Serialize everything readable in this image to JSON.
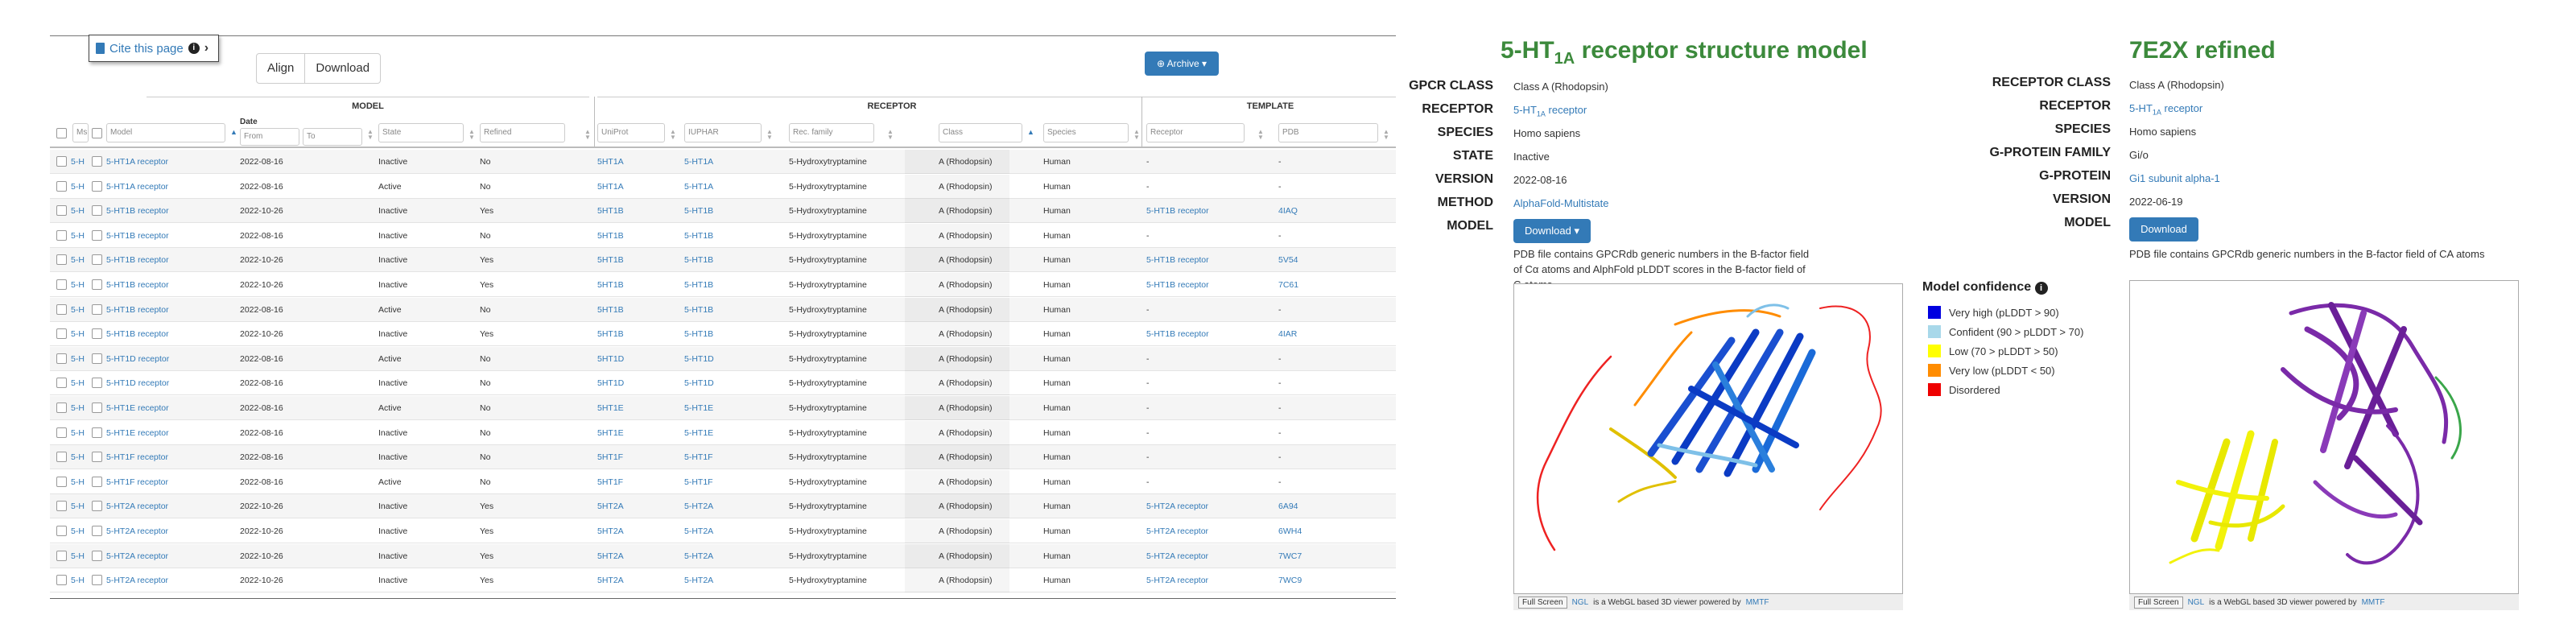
{
  "left": {
    "cite_label": "Cite this page",
    "buttons": {
      "align": "Align",
      "download": "Download"
    },
    "archive_label": "Archive",
    "groups": {
      "model": "MODEL",
      "receptor": "RECEPTOR",
      "template": "TEMPLATE"
    },
    "headers": {
      "ms": "Ms",
      "model": "Model",
      "date": "Date",
      "date_from": "From",
      "date_to": "To",
      "state": "State",
      "refined": "Refined",
      "uniprot": "UniProt",
      "iuphar": "IUPHAR",
      "rec_family": "Rec. family",
      "class": "Class",
      "species": "Species",
      "receptor": "Receptor",
      "pdb": "PDB"
    },
    "rows": [
      {
        "ms": "5-H",
        "model": "5-HT1A receptor",
        "date": "2022-08-16",
        "state": "Inactive",
        "refined": "No",
        "uniprot": "5HT1A",
        "iuphar": "5-HT1A",
        "family": "5-Hydroxytryptamine",
        "cls": "A (Rhodopsin)",
        "species": "Human",
        "treceptor": "-",
        "pdb": "-"
      },
      {
        "ms": "5-H",
        "model": "5-HT1A receptor",
        "date": "2022-08-16",
        "state": "Active",
        "refined": "No",
        "uniprot": "5HT1A",
        "iuphar": "5-HT1A",
        "family": "5-Hydroxytryptamine",
        "cls": "A (Rhodopsin)",
        "species": "Human",
        "treceptor": "-",
        "pdb": "-"
      },
      {
        "ms": "5-H",
        "model": "5-HT1B receptor",
        "date": "2022-10-26",
        "state": "Inactive",
        "refined": "Yes",
        "uniprot": "5HT1B",
        "iuphar": "5-HT1B",
        "family": "5-Hydroxytryptamine",
        "cls": "A (Rhodopsin)",
        "species": "Human",
        "treceptor": "5-HT1B receptor",
        "pdb": "4IAQ"
      },
      {
        "ms": "5-H",
        "model": "5-HT1B receptor",
        "date": "2022-08-16",
        "state": "Inactive",
        "refined": "No",
        "uniprot": "5HT1B",
        "iuphar": "5-HT1B",
        "family": "5-Hydroxytryptamine",
        "cls": "A (Rhodopsin)",
        "species": "Human",
        "treceptor": "-",
        "pdb": "-"
      },
      {
        "ms": "5-H",
        "model": "5-HT1B receptor",
        "date": "2022-10-26",
        "state": "Inactive",
        "refined": "Yes",
        "uniprot": "5HT1B",
        "iuphar": "5-HT1B",
        "family": "5-Hydroxytryptamine",
        "cls": "A (Rhodopsin)",
        "species": "Human",
        "treceptor": "5-HT1B receptor",
        "pdb": "5V54"
      },
      {
        "ms": "5-H",
        "model": "5-HT1B receptor",
        "date": "2022-10-26",
        "state": "Inactive",
        "refined": "Yes",
        "uniprot": "5HT1B",
        "iuphar": "5-HT1B",
        "family": "5-Hydroxytryptamine",
        "cls": "A (Rhodopsin)",
        "species": "Human",
        "treceptor": "5-HT1B receptor",
        "pdb": "7C61"
      },
      {
        "ms": "5-H",
        "model": "5-HT1B receptor",
        "date": "2022-08-16",
        "state": "Active",
        "refined": "No",
        "uniprot": "5HT1B",
        "iuphar": "5-HT1B",
        "family": "5-Hydroxytryptamine",
        "cls": "A (Rhodopsin)",
        "species": "Human",
        "treceptor": "-",
        "pdb": "-"
      },
      {
        "ms": "5-H",
        "model": "5-HT1B receptor",
        "date": "2022-10-26",
        "state": "Inactive",
        "refined": "Yes",
        "uniprot": "5HT1B",
        "iuphar": "5-HT1B",
        "family": "5-Hydroxytryptamine",
        "cls": "A (Rhodopsin)",
        "species": "Human",
        "treceptor": "5-HT1B receptor",
        "pdb": "4IAR"
      },
      {
        "ms": "5-H",
        "model": "5-HT1D receptor",
        "date": "2022-08-16",
        "state": "Active",
        "refined": "No",
        "uniprot": "5HT1D",
        "iuphar": "5-HT1D",
        "family": "5-Hydroxytryptamine",
        "cls": "A (Rhodopsin)",
        "species": "Human",
        "treceptor": "-",
        "pdb": "-"
      },
      {
        "ms": "5-H",
        "model": "5-HT1D receptor",
        "date": "2022-08-16",
        "state": "Inactive",
        "refined": "No",
        "uniprot": "5HT1D",
        "iuphar": "5-HT1D",
        "family": "5-Hydroxytryptamine",
        "cls": "A (Rhodopsin)",
        "species": "Human",
        "treceptor": "-",
        "pdb": "-"
      },
      {
        "ms": "5-H",
        "model": "5-HT1E receptor",
        "date": "2022-08-16",
        "state": "Active",
        "refined": "No",
        "uniprot": "5HT1E",
        "iuphar": "5-HT1E",
        "family": "5-Hydroxytryptamine",
        "cls": "A (Rhodopsin)",
        "species": "Human",
        "treceptor": "-",
        "pdb": "-"
      },
      {
        "ms": "5-H",
        "model": "5-HT1E receptor",
        "date": "2022-08-16",
        "state": "Inactive",
        "refined": "No",
        "uniprot": "5HT1E",
        "iuphar": "5-HT1E",
        "family": "5-Hydroxytryptamine",
        "cls": "A (Rhodopsin)",
        "species": "Human",
        "treceptor": "-",
        "pdb": "-"
      },
      {
        "ms": "5-H",
        "model": "5-HT1F receptor",
        "date": "2022-08-16",
        "state": "Inactive",
        "refined": "No",
        "uniprot": "5HT1F",
        "iuphar": "5-HT1F",
        "family": "5-Hydroxytryptamine",
        "cls": "A (Rhodopsin)",
        "species": "Human",
        "treceptor": "-",
        "pdb": "-"
      },
      {
        "ms": "5-H",
        "model": "5-HT1F receptor",
        "date": "2022-08-16",
        "state": "Active",
        "refined": "No",
        "uniprot": "5HT1F",
        "iuphar": "5-HT1F",
        "family": "5-Hydroxytryptamine",
        "cls": "A (Rhodopsin)",
        "species": "Human",
        "treceptor": "-",
        "pdb": "-"
      },
      {
        "ms": "5-H",
        "model": "5-HT2A receptor",
        "date": "2022-10-26",
        "state": "Inactive",
        "refined": "Yes",
        "uniprot": "5HT2A",
        "iuphar": "5-HT2A",
        "family": "5-Hydroxytryptamine",
        "cls": "A (Rhodopsin)",
        "species": "Human",
        "treceptor": "5-HT2A receptor",
        "pdb": "6A94"
      },
      {
        "ms": "5-H",
        "model": "5-HT2A receptor",
        "date": "2022-10-26",
        "state": "Inactive",
        "refined": "Yes",
        "uniprot": "5HT2A",
        "iuphar": "5-HT2A",
        "family": "5-Hydroxytryptamine",
        "cls": "A (Rhodopsin)",
        "species": "Human",
        "treceptor": "5-HT2A receptor",
        "pdb": "6WH4"
      },
      {
        "ms": "5-H",
        "model": "5-HT2A receptor",
        "date": "2022-10-26",
        "state": "Inactive",
        "refined": "Yes",
        "uniprot": "5HT2A",
        "iuphar": "5-HT2A",
        "family": "5-Hydroxytryptamine",
        "cls": "A (Rhodopsin)",
        "species": "Human",
        "treceptor": "5-HT2A receptor",
        "pdb": "7WC7"
      },
      {
        "ms": "5-H",
        "model": "5-HT2A receptor",
        "date": "2022-10-26",
        "state": "Inactive",
        "refined": "Yes",
        "uniprot": "5HT2A",
        "iuphar": "5-HT2A",
        "family": "5-Hydroxytryptamine",
        "cls": "A (Rhodopsin)",
        "species": "Human",
        "treceptor": "5-HT2A receptor",
        "pdb": "7WC9"
      }
    ]
  },
  "middle": {
    "title_prefix": "5-HT",
    "title_sub": "1A",
    "title_suffix": " receptor structure model",
    "labels": {
      "class": "GPCR CLASS",
      "receptor": "RECEPTOR",
      "species": "SPECIES",
      "state": "STATE",
      "version": "VERSION",
      "method": "METHOD",
      "model": "MODEL"
    },
    "values": {
      "class": "Class A (Rhodopsin)",
      "receptor": "5-HT1A receptor",
      "species": "Homo sapiens",
      "state": "Inactive",
      "version": "2022-08-16",
      "method": "AlphaFold-Multistate"
    },
    "download_label": "Download",
    "note": "PDB file contains GPCRdb generic numbers in the B-factor field of Cα atoms and AlphFold pLDDT scores in the B-factor field of C atoms",
    "viewer_fullscreen": "Full Screen",
    "viewer_credit_ngl": "NGL",
    "viewer_credit_mid": "is a WebGL based 3D viewer powered by",
    "viewer_credit_mmtf": "MMTF"
  },
  "legend": {
    "title": "Model confidence",
    "items": [
      {
        "label": "Very high (pLDDT > 90)",
        "color": "#0000e0"
      },
      {
        "label": "Confident (90 > pLDDT > 70)",
        "color": "#a8d8ea"
      },
      {
        "label": "Low (70 > pLDDT > 50)",
        "color": "#ffff00"
      },
      {
        "label": "Very low (pLDDT < 50)",
        "color": "#ff8c00"
      },
      {
        "label": "Disordered",
        "color": "#ee0000"
      }
    ]
  },
  "right": {
    "title": "7E2X refined",
    "labels": {
      "rclass": "RECEPTOR CLASS",
      "receptor": "RECEPTOR",
      "species": "SPECIES",
      "gfamily": "G-PROTEIN FAMILY",
      "gprotein": "G-PROTEIN",
      "version": "VERSION",
      "model": "MODEL"
    },
    "values": {
      "rclass": "Class A (Rhodopsin)",
      "receptor": "5-HT1A receptor",
      "species": "Homo sapiens",
      "gfamily": "Gi/o",
      "gprotein": "Gi1 subunit alpha-1",
      "version": "2022-06-19"
    },
    "download_label": "Download",
    "note": "PDB file contains GPCRdb generic numbers in the B-factor field of CA atoms",
    "viewer_fullscreen": "Full Screen",
    "viewer_credit_ngl": "NGL",
    "viewer_credit_mid": "is a WebGL based 3D viewer powered by",
    "viewer_credit_mmtf": "MMTF"
  },
  "colors": {
    "accent": "#337ab7",
    "title_green": "#3c8a3c",
    "purple": "#7a2aa8",
    "yellow": "#f2f20a",
    "green_loop": "#3aa64a"
  }
}
